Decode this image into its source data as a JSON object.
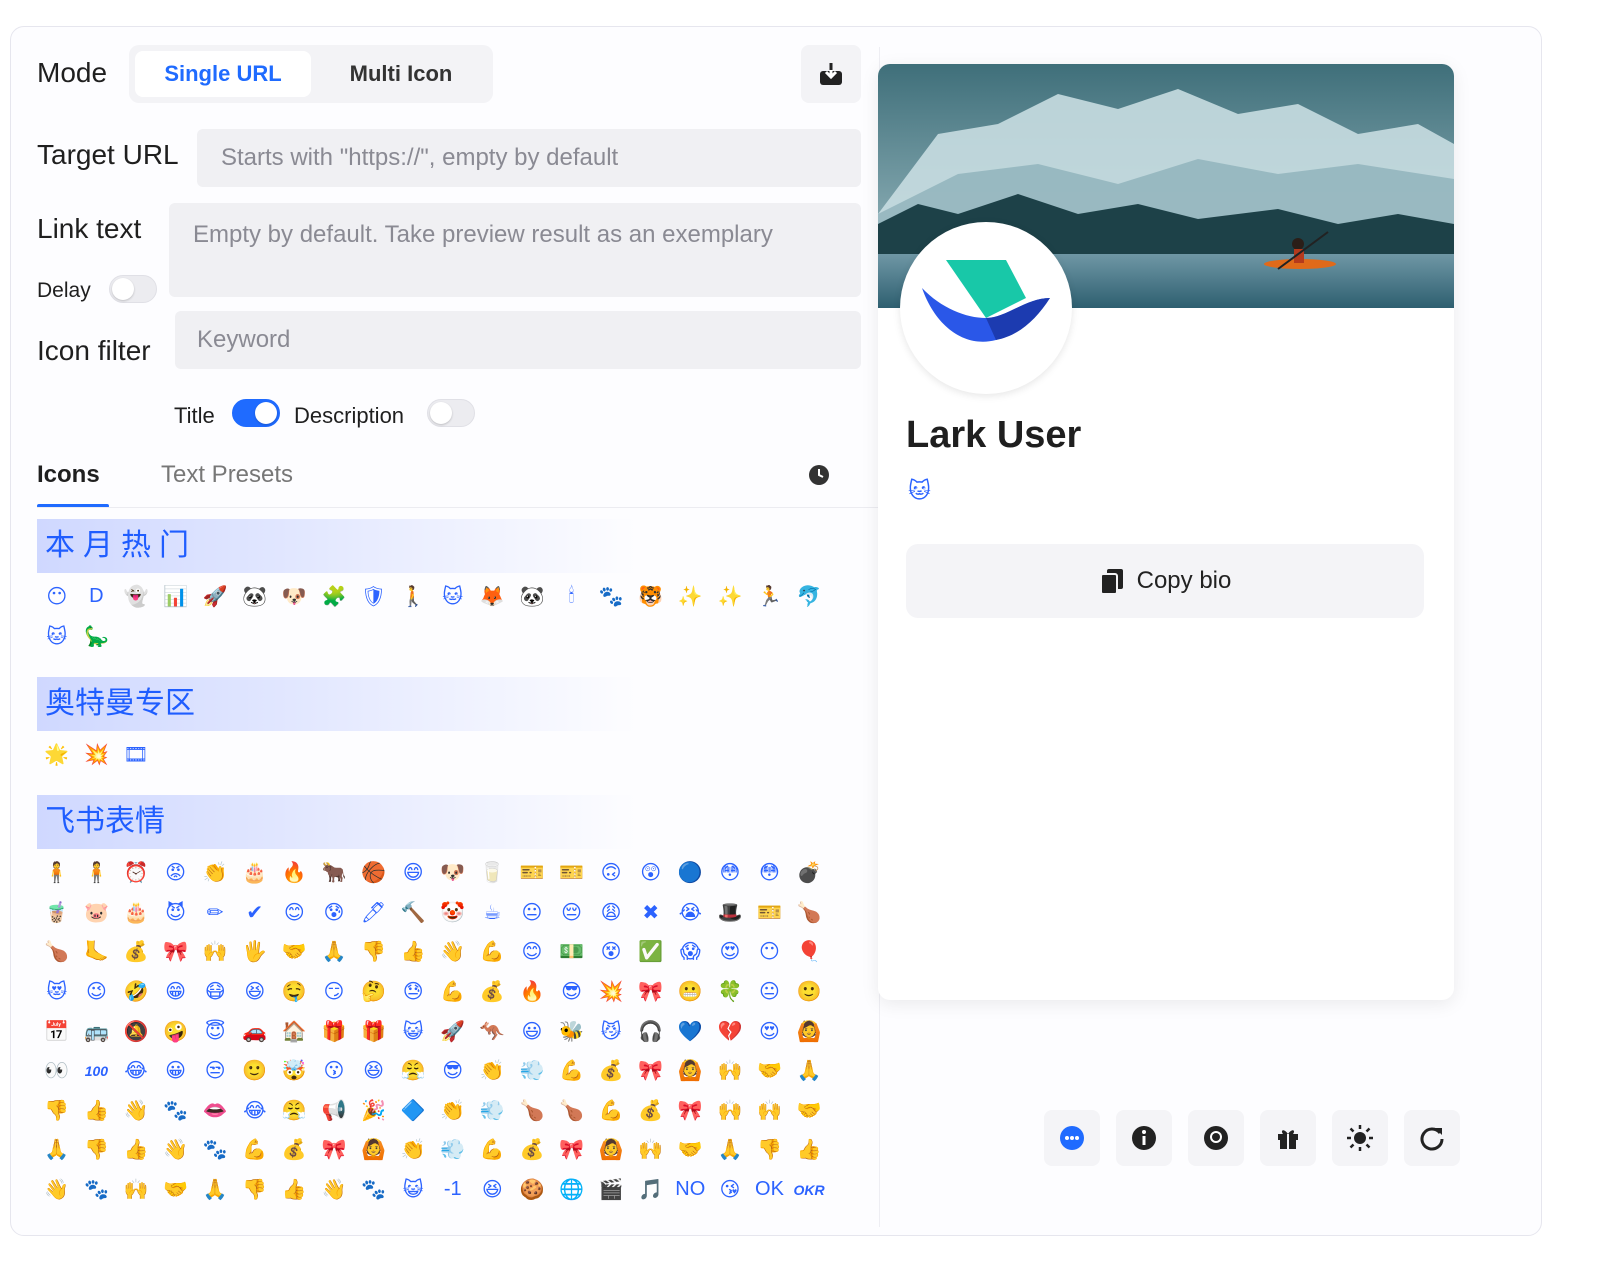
{
  "form": {
    "mode_label": "Mode",
    "mode_options": [
      "Single URL",
      "Multi Icon"
    ],
    "target_url_label": "Target URL",
    "target_url_placeholder": "Starts with \"https://\", empty by default",
    "link_text_label": "Link text",
    "link_text_placeholder": "Empty by default. Take preview result as an exemplary",
    "delay_label": "Delay",
    "icon_filter_label": "Icon filter",
    "icon_filter_placeholder": "Keyword",
    "title_toggle_label": "Title",
    "description_toggle_label": "Description",
    "delay_on": false,
    "title_on": true,
    "description_on": false
  },
  "tabs": [
    "Icons",
    "Text Presets"
  ],
  "categories": [
    {
      "name": "本月热门",
      "icons": [
        "😶",
        "D",
        "👻",
        "📊",
        "🚀",
        "🐼",
        "🐶",
        "🧩",
        "🛡",
        "🚶",
        "🐱",
        "🦊",
        "🐼",
        "🕯",
        "🐾",
        "🐯",
        "✨",
        "✨",
        "🏃",
        "🐬",
        "🐱",
        "🦕"
      ]
    },
    {
      "name": "奥特曼专区",
      "icons": [
        "🌟",
        "💥",
        "🎞"
      ]
    },
    {
      "name": "飞书表情",
      "icons": [
        "🧍",
        "🧍",
        "⏰",
        "😡",
        "👏",
        "🎂",
        "🔥",
        "🐂",
        "🏀",
        "😄",
        "🐶",
        "🥛",
        "🎫",
        "🎫",
        "🙃",
        "😲",
        "🔵",
        "😳",
        "😳",
        "💣",
        "🧋",
        "🐷",
        "🎂",
        "😈",
        "✏",
        "✔",
        "😊",
        "😰",
        "🖊",
        "🔨",
        "🤡",
        "☕",
        "😐",
        "😔",
        "😩",
        "✖",
        "😭",
        "🎩",
        "🎫",
        "🍗",
        "🍗",
        "🦶",
        "💰",
        "🎀",
        "🙌",
        "🖐",
        "🤝",
        "🙏",
        "👎",
        "👍",
        "👋",
        "💪",
        "😊",
        "💵",
        "😵",
        "✅",
        "😱",
        "😍",
        "😶",
        "🎈",
        "😻",
        "😉",
        "🤣",
        "😁",
        "😷",
        "😆",
        "🤤",
        "😏",
        "🤔",
        "😓",
        "💪",
        "💰",
        "🔥",
        "😎",
        "💥",
        "🎀",
        "😬",
        "🍀",
        "😐",
        "🙂",
        "📅",
        "🚌",
        "🔕",
        "🤪",
        "😇",
        "🚗",
        "🏠",
        "🎁",
        "🎁",
        "😺",
        "🚀",
        "🦘",
        "😃",
        "🐝",
        "😼",
        "🎧",
        "💙",
        "💔",
        "😍",
        "🙆",
        "👀",
        "100",
        "😂",
        "😀",
        "😒",
        "🙂",
        "🤯",
        "😗",
        "😆",
        "😤",
        "😎",
        "👏",
        "💨",
        "💪",
        "💰",
        "🎀",
        "🙆",
        "🙌",
        "🤝",
        "🙏",
        "👎",
        "👍",
        "👋",
        "🐾",
        "👄",
        "😂",
        "😤",
        "📢",
        "🎉",
        "🔷",
        "👏",
        "💨",
        "🍗",
        "🍗",
        "💪",
        "💰",
        "🎀",
        "🙌",
        "🙌",
        "🤝",
        "🙏",
        "👎",
        "👍",
        "👋",
        "🐾",
        "💪",
        "💰",
        "🎀",
        "🙆",
        "👏",
        "💨",
        "💪",
        "💰",
        "🎀",
        "🙆",
        "🙌",
        "🤝",
        "🙏",
        "👎",
        "👍",
        "👋",
        "🐾",
        "🙌",
        "🤝",
        "🙏",
        "👎",
        "👍",
        "👋",
        "🐾",
        "😺",
        "-1",
        "😆",
        "🍪",
        "🌐",
        "🎬",
        "🎵",
        "NO",
        "😘",
        "OK",
        "OKR"
      ]
    }
  ],
  "preview": {
    "user_name": "Lark User",
    "copy_bio_label": "Copy bio",
    "bio_icon": "🐱"
  },
  "colors": {
    "accent": "#1f6bff",
    "icon_blue": "#2c63ff"
  }
}
